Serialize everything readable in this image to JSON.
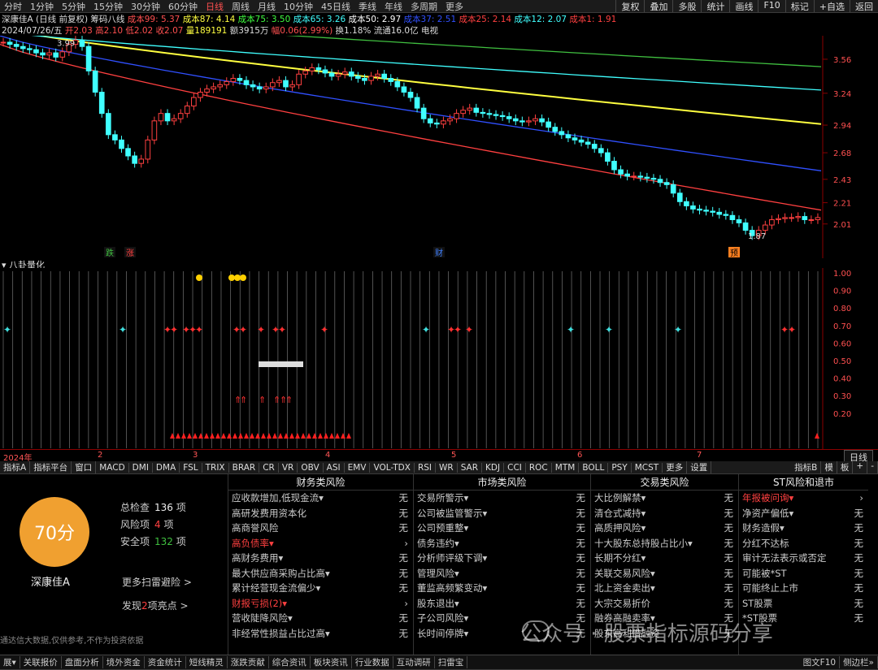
{
  "period_bar": {
    "items": [
      "分时",
      "1分钟",
      "5分钟",
      "15分钟",
      "30分钟",
      "60分钟",
      "日线",
      "周线",
      "月线",
      "10分钟",
      "45日线",
      "季线",
      "年线",
      "多周期",
      "更多"
    ],
    "active": "日线",
    "right": [
      "复权",
      "叠加",
      "多股",
      "统计",
      "画线",
      "F10",
      "标记",
      "+自选",
      "返回"
    ]
  },
  "info_line1": {
    "title": "深康佳A (日线 前复权)",
    "indicator": "筹码八线",
    "items": [
      {
        "t": "成本99: 5.37",
        "c": "#ff5050"
      },
      {
        "t": "成本87: 4.14",
        "c": "#ffff40"
      },
      {
        "t": "成本75: 3.50",
        "c": "#40ff40"
      },
      {
        "t": "成本65: 3.26",
        "c": "#40ffff"
      },
      {
        "t": "成本50: 2.97",
        "c": "#ffffff"
      },
      {
        "t": "成本37: 2.51",
        "c": "#3050ff"
      },
      {
        "t": "成本25: 2.14",
        "c": "#ff4040"
      },
      {
        "t": "成本12: 2.07",
        "c": "#40ffff"
      },
      {
        "t": "成本1: 1.91",
        "c": "#ff4040"
      }
    ]
  },
  "info_line2": {
    "items": [
      {
        "t": "2024/07/26/五",
        "c": "#dddddd"
      },
      {
        "t": "开2.03",
        "c": "#ff5050"
      },
      {
        "t": "高2.10",
        "c": "#ff5050"
      },
      {
        "t": "低2.02",
        "c": "#ff5050"
      },
      {
        "t": "收2.07",
        "c": "#ff5050"
      },
      {
        "t": "量189191",
        "c": "#ffff40"
      },
      {
        "t": "额3915万",
        "c": "#dddddd"
      },
      {
        "t": "幅0.06(2.99%)",
        "c": "#ff5050"
      },
      {
        "t": "换1.18%",
        "c": "#dddddd"
      },
      {
        "t": "流通16.0亿",
        "c": "#dddddd"
      },
      {
        "t": "电视",
        "c": "#dddddd"
      }
    ]
  },
  "chart_data": {
    "type": "candlestick",
    "y_ticks": [
      3.56,
      3.24,
      2.94,
      2.68,
      2.43,
      2.21,
      2.01
    ],
    "ylim": [
      1.84,
      3.72
    ],
    "annotations": {
      "high": "3.99",
      "low": "1.87"
    },
    "markers": [
      "跌",
      "涨",
      "财",
      "预"
    ],
    "months": [
      "2024年",
      "2",
      "3",
      "4",
      "5",
      "6",
      "7"
    ],
    "close": [
      3.72,
      3.7,
      3.68,
      3.66,
      3.65,
      3.62,
      3.6,
      3.62,
      3.58,
      3.63,
      3.7,
      3.74,
      3.68,
      3.45,
      3.25,
      3.05,
      2.85,
      2.8,
      2.72,
      2.65,
      2.58,
      2.62,
      2.8,
      2.98,
      3.05,
      2.98,
      3.0,
      3.05,
      3.12,
      3.2,
      3.25,
      3.28,
      3.3,
      3.32,
      3.35,
      3.38,
      3.36,
      3.32,
      3.3,
      3.28,
      3.3,
      3.34,
      3.36,
      3.3,
      3.32,
      3.42,
      3.45,
      3.48,
      3.46,
      3.43,
      3.4,
      3.42,
      3.44,
      3.4,
      3.38,
      3.36,
      3.4,
      3.42,
      3.38,
      3.35,
      3.3,
      3.25,
      3.2,
      3.1,
      3.0,
      2.96,
      2.95,
      2.98,
      3.0,
      3.05,
      3.08,
      3.1,
      3.06,
      3.05,
      3.04,
      3.03,
      3.02,
      3.0,
      2.98,
      2.97,
      2.98,
      3.0,
      2.97,
      2.92,
      2.88,
      2.85,
      2.82,
      2.8,
      2.78,
      2.76,
      2.72,
      2.68,
      2.6,
      2.52,
      2.48,
      2.46,
      2.46,
      2.45,
      2.44,
      2.43,
      2.4,
      2.38,
      2.3,
      2.22,
      2.18,
      2.15,
      2.14,
      2.13,
      2.12,
      2.1,
      2.09,
      2.05,
      2.02,
      1.95,
      1.9,
      1.95,
      2.0,
      2.05,
      2.06,
      2.07,
      2.07,
      2.08,
      2.05,
      2.05,
      2.07
    ],
    "cost_lines": [
      {
        "label": "成本87",
        "color": "#ffff40",
        "start": 3.85,
        "end": 2.95
      },
      {
        "label": "成本75",
        "color": "#40c040",
        "start": 3.99,
        "end": 3.49
      },
      {
        "label": "成本65",
        "color": "#40ffff",
        "start": 3.82,
        "end": 3.27
      },
      {
        "label": "成本37",
        "color": "#3050ff",
        "start": 3.78,
        "end": 2.51
      },
      {
        "label": "成本25",
        "color": "#ff4040",
        "start": 3.7,
        "end": 2.14
      }
    ]
  },
  "indicator": {
    "title": "八卦量化",
    "y_ticks": [
      "1.00",
      "0.90",
      "0.80",
      "0.70",
      "0.60",
      "0.50",
      "0.40",
      "0.30",
      "0.20"
    ]
  },
  "tab_bar": {
    "items": [
      "指标A",
      "指标平台",
      "窗口",
      "MACD",
      "DMI",
      "DMA",
      "FSL",
      "TRIX",
      "BRAR",
      "CR",
      "VR",
      "OBV",
      "ASI",
      "EMV",
      "VOL-TDX",
      "RSI",
      "WR",
      "SAR",
      "KDJ",
      "CCI",
      "ROC",
      "MTM",
      "BOLL",
      "PSY",
      "MCST",
      "更多",
      "设置"
    ],
    "right": [
      "指标B",
      "模",
      "板",
      "+",
      "-"
    ]
  },
  "day_button": "日线",
  "score_panel": {
    "score": "70分",
    "name": "深康佳A",
    "total_label": "总检查",
    "total_value": "136",
    "total_unit": "项",
    "risk_label": "风险项",
    "risk_value": "4",
    "risk_unit": "项",
    "safe_label": "安全项",
    "safe_value": "132",
    "safe_unit": "项",
    "more_link": "更多扫雷避险 >",
    "found_prefix": "发现",
    "found_value": "2",
    "found_suffix": "项亮点 >",
    "disclaimer": "通达信大数据,仅供参考,不作为投资依据"
  },
  "columns": [
    {
      "title": "财务类风险",
      "rows": [
        {
          "n": "应收款增加,低现金流▾",
          "s": "无",
          "r": false
        },
        {
          "n": "高研发费用资本化",
          "s": "无",
          "r": false
        },
        {
          "n": "高商誉风险",
          "s": "无",
          "r": false
        },
        {
          "n": "高负债率▾",
          "s": "›",
          "r": true
        },
        {
          "n": "高财务费用▾",
          "s": "无",
          "r": false
        },
        {
          "n": "最大供应商采购占比高▾",
          "s": "无",
          "r": false
        },
        {
          "n": "累计经营现金流偏少▾",
          "s": "无",
          "r": false
        },
        {
          "n": "财报亏损(2)▾",
          "s": "›",
          "r": true
        },
        {
          "n": "营收陡降风险▾",
          "s": "无",
          "r": false
        },
        {
          "n": "非经常性损益占比过高▾",
          "s": "无",
          "r": false
        }
      ]
    },
    {
      "title": "市场类风险",
      "rows": [
        {
          "n": "交易所警示▾",
          "s": "无",
          "r": false
        },
        {
          "n": "公司被监管警示▾",
          "s": "无",
          "r": false
        },
        {
          "n": "公司预重整▾",
          "s": "无",
          "r": false
        },
        {
          "n": "债务违约▾",
          "s": "无",
          "r": false
        },
        {
          "n": "分析师评级下调▾",
          "s": "无",
          "r": false
        },
        {
          "n": "管理风险▾",
          "s": "无",
          "r": false
        },
        {
          "n": "董监高频繁变动▾",
          "s": "无",
          "r": false
        },
        {
          "n": "股东退出▾",
          "s": "无",
          "r": false
        },
        {
          "n": "子公司风险▾",
          "s": "无",
          "r": false
        },
        {
          "n": "长时间停牌▾",
          "s": "无",
          "r": false
        }
      ]
    },
    {
      "title": "交易类风险",
      "rows": [
        {
          "n": "大比例解禁▾",
          "s": "无",
          "r": false
        },
        {
          "n": "清仓式减持▾",
          "s": "无",
          "r": false
        },
        {
          "n": "高质押风险▾",
          "s": "无",
          "r": false
        },
        {
          "n": "十大股东总持股占比小▾",
          "s": "无",
          "r": false
        },
        {
          "n": "长期不分红▾",
          "s": "无",
          "r": false
        },
        {
          "n": "关联交易风险▾",
          "s": "无",
          "r": false
        },
        {
          "n": "北上资金卖出▾",
          "s": "无",
          "r": false
        },
        {
          "n": "大宗交易折价",
          "s": "无",
          "r": false
        },
        {
          "n": "融券高融卖率▾",
          "s": "无",
          "r": false
        },
        {
          "n": "股东高利借融资",
          "s": "无",
          "r": false
        }
      ]
    },
    {
      "title": "ST风险和退市",
      "rows": [
        {
          "n": "年报被问询▾",
          "s": "›",
          "r": true
        },
        {
          "n": "净资产偏低▾",
          "s": "无",
          "r": false
        },
        {
          "n": "财务造假▾",
          "s": "无",
          "r": false
        },
        {
          "n": "分红不达标",
          "s": "无",
          "r": false
        },
        {
          "n": "审计无法表示或否定",
          "s": "无",
          "r": false
        },
        {
          "n": "可能被*ST",
          "s": "无",
          "r": false
        },
        {
          "n": "可能终止上市",
          "s": "无",
          "r": false
        },
        {
          "n": "ST股票",
          "s": "无",
          "r": false
        },
        {
          "n": "*ST股票",
          "s": "无",
          "r": false
        },
        {
          "n": "",
          "s": "",
          "r": false
        }
      ]
    }
  ],
  "footer": {
    "items": [
      "展▾",
      "关联报价",
      "盘面分析",
      "境外资金",
      "资金统计",
      "短线精灵",
      "涨跌贡献",
      "综合资讯",
      "板块资讯",
      "行业数据",
      "互动调研",
      "扫雷宝"
    ],
    "right": [
      "图文F10",
      "侧边栏»"
    ]
  },
  "watermark": "公众号 · 股票指标源码分享"
}
